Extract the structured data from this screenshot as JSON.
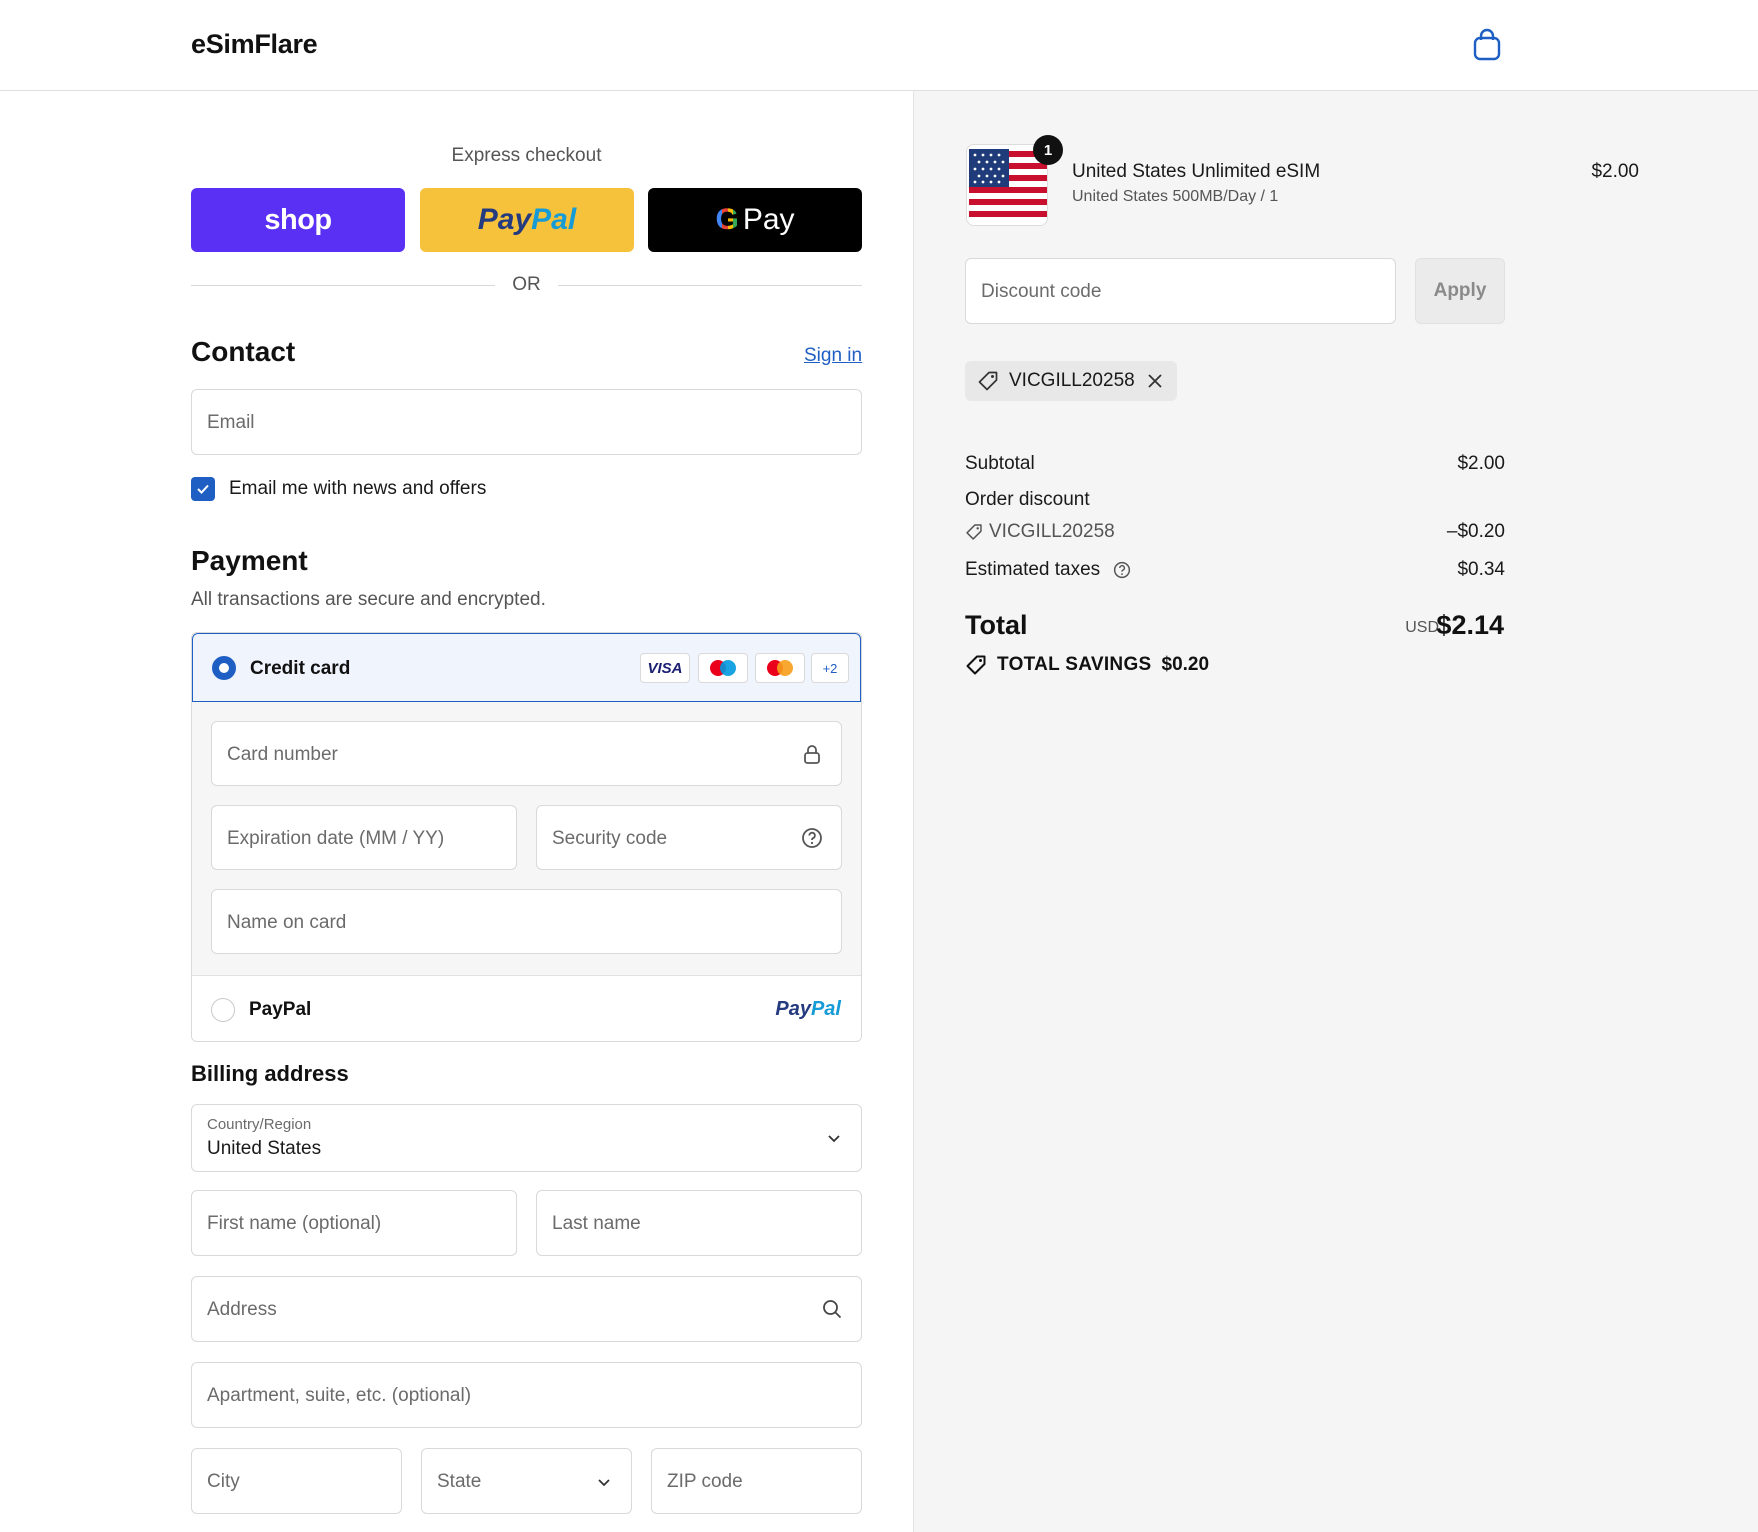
{
  "header": {
    "logo": "eSimFlare",
    "cart_icon": "shopping-bag-icon"
  },
  "express": {
    "label": "Express checkout",
    "shop_label": "shop",
    "paypal_label_a": "Pay",
    "paypal_label_b": "Pal",
    "gpay_g": "G",
    "gpay_label": "Pay",
    "or_label": "OR"
  },
  "contact": {
    "title": "Contact",
    "sign_in": "Sign in",
    "email_placeholder": "Email",
    "newsletter_label": "Email me with news and offers",
    "newsletter_checked": true
  },
  "payment": {
    "title": "Payment",
    "subtitle": "All transactions are secure and encrypted.",
    "credit_card_label": "Credit card",
    "brands": [
      "VISA",
      "maestro",
      "mastercard",
      "+2"
    ],
    "card_number_placeholder": "Card number",
    "expiration_placeholder": "Expiration date (MM / YY)",
    "security_placeholder": "Security code",
    "name_placeholder": "Name on card",
    "paypal_label": "PayPal",
    "paypal_logo_a": "Pay",
    "paypal_logo_b": "Pal",
    "selected": "Credit card"
  },
  "billing": {
    "title": "Billing address",
    "country_label": "Country/Region",
    "country_value": "United States",
    "first_name_placeholder": "First name (optional)",
    "last_name_placeholder": "Last name",
    "address_placeholder": "Address",
    "apartment_placeholder": "Apartment, suite, etc. (optional)",
    "city_placeholder": "City",
    "state_placeholder": "State",
    "zip_placeholder": "ZIP code"
  },
  "summary": {
    "item": {
      "quantity": "1",
      "title": "United States Unlimited eSIM",
      "variant": "United States 500MB/Day / 1",
      "price": "$2.00"
    },
    "discount_placeholder": "Discount code",
    "apply_label": "Apply",
    "applied_code": "VICGILL20258",
    "subtotal_label": "Subtotal",
    "subtotal_value": "$2.00",
    "order_discount_label": "Order discount",
    "order_discount_code": "VICGILL20258",
    "order_discount_value": "–$0.20",
    "taxes_label": "Estimated taxes",
    "taxes_value": "$0.34",
    "total_label": "Total",
    "currency": "USD",
    "total_value": "$2.14",
    "savings_label": "TOTAL SAVINGS",
    "savings_value": "$0.20"
  },
  "colors": {
    "accent": "#1f5fc4",
    "shop": "#5a31f4",
    "paypal": "#f6c23b",
    "gpay": "#000000"
  }
}
